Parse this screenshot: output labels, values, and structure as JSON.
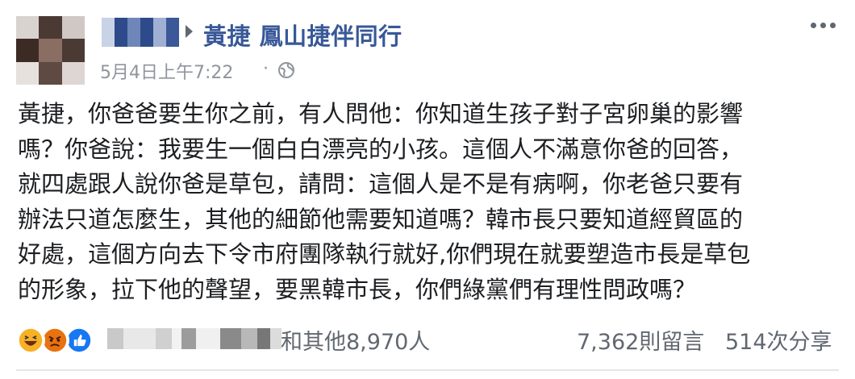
{
  "post": {
    "author_separator": "▶",
    "page_name": "黃捷 鳳山捷伴同行",
    "timestamp": "5月4日上午7:22",
    "dot": "·",
    "privacy_icon": "globe-icon",
    "more_icon": "more-options-icon",
    "body_lines": [
      "黃捷，你爸爸要生你之前，有人問他：你知道生孩子對子宮卵巢的影響",
      "嗎？你爸說：我要生一個白白漂亮的小孩。這個人不滿意你爸的回答，",
      "就四處跟人說你爸是草包，請問：這個人是不是有病啊，你老爸只要有",
      "辦法只道怎麼生，其他的細節他需要知道嗎？韓市長只要知道經貿區的",
      "好處，這個方向去下令市府團隊執行就好,你們現在就要塑造市長是草包",
      "的形象，拉下他的聲望，要黑韓市長，你們綠黨們有理性問政嗎？"
    ]
  },
  "footer": {
    "reactions": [
      "haha-reaction-icon",
      "angry-reaction-icon",
      "like-reaction-icon"
    ],
    "reactors_tail": "和其他8,970人",
    "comments": "7,362則留言",
    "shares": "514次分享"
  },
  "colors": {
    "link": "#385898",
    "meta": "#90949c",
    "footer_text": "#606770",
    "like_blue": "#1877f2",
    "haha_yellow": "#f7b125",
    "angry_red": "#e9710f"
  }
}
